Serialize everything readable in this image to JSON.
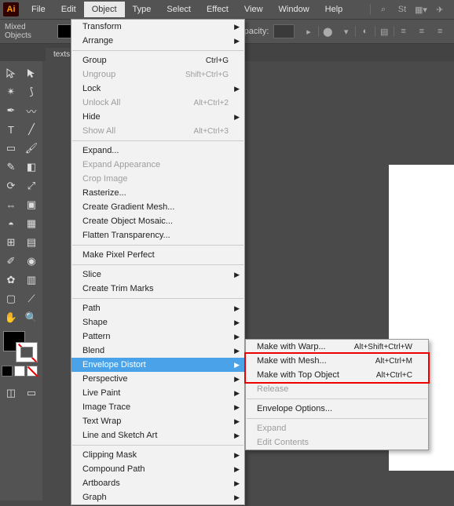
{
  "app": {
    "icon": "Ai"
  },
  "menubar": {
    "items": [
      "File",
      "Edit",
      "Object",
      "Type",
      "Select",
      "Effect",
      "View",
      "Window",
      "Help"
    ],
    "open_index": 2
  },
  "optbar": {
    "mixed": "Mixed Objects",
    "opacity_label": "Opacity:"
  },
  "tab": {
    "name": "texts."
  },
  "dropdown": {
    "groups": [
      [
        {
          "label": "Transform",
          "arrow": true
        },
        {
          "label": "Arrange",
          "arrow": true
        }
      ],
      [
        {
          "label": "Group",
          "shortcut": "Ctrl+G"
        },
        {
          "label": "Ungroup",
          "shortcut": "Shift+Ctrl+G",
          "disabled": true
        },
        {
          "label": "Lock",
          "arrow": true
        },
        {
          "label": "Unlock All",
          "shortcut": "Alt+Ctrl+2",
          "disabled": true
        },
        {
          "label": "Hide",
          "arrow": true
        },
        {
          "label": "Show All",
          "shortcut": "Alt+Ctrl+3",
          "disabled": true
        }
      ],
      [
        {
          "label": "Expand..."
        },
        {
          "label": "Expand Appearance",
          "disabled": true
        },
        {
          "label": "Crop Image",
          "disabled": true
        },
        {
          "label": "Rasterize..."
        },
        {
          "label": "Create Gradient Mesh..."
        },
        {
          "label": "Create Object Mosaic..."
        },
        {
          "label": "Flatten Transparency..."
        }
      ],
      [
        {
          "label": "Make Pixel Perfect"
        }
      ],
      [
        {
          "label": "Slice",
          "arrow": true
        },
        {
          "label": "Create Trim Marks"
        }
      ],
      [
        {
          "label": "Path",
          "arrow": true
        },
        {
          "label": "Shape",
          "arrow": true
        },
        {
          "label": "Pattern",
          "arrow": true
        },
        {
          "label": "Blend",
          "arrow": true
        },
        {
          "label": "Envelope Distort",
          "arrow": true,
          "highlight": true
        },
        {
          "label": "Perspective",
          "arrow": true
        },
        {
          "label": "Live Paint",
          "arrow": true
        },
        {
          "label": "Image Trace",
          "arrow": true
        },
        {
          "label": "Text Wrap",
          "arrow": true
        },
        {
          "label": "Line and Sketch Art",
          "arrow": true
        }
      ],
      [
        {
          "label": "Clipping Mask",
          "arrow": true
        },
        {
          "label": "Compound Path",
          "arrow": true
        },
        {
          "label": "Artboards",
          "arrow": true
        },
        {
          "label": "Graph",
          "arrow": true
        }
      ]
    ]
  },
  "submenu": {
    "groups": [
      [
        {
          "label": "Make with Warp...",
          "shortcut": "Alt+Shift+Ctrl+W"
        },
        {
          "label": "Make with Mesh...",
          "shortcut": "Alt+Ctrl+M"
        },
        {
          "label": "Make with Top Object",
          "shortcut": "Alt+Ctrl+C",
          "boxed": true
        },
        {
          "label": "Release",
          "disabled": true
        }
      ],
      [
        {
          "label": "Envelope Options..."
        }
      ],
      [
        {
          "label": "Expand",
          "disabled": true
        },
        {
          "label": "Edit Contents",
          "disabled": true
        }
      ]
    ]
  }
}
